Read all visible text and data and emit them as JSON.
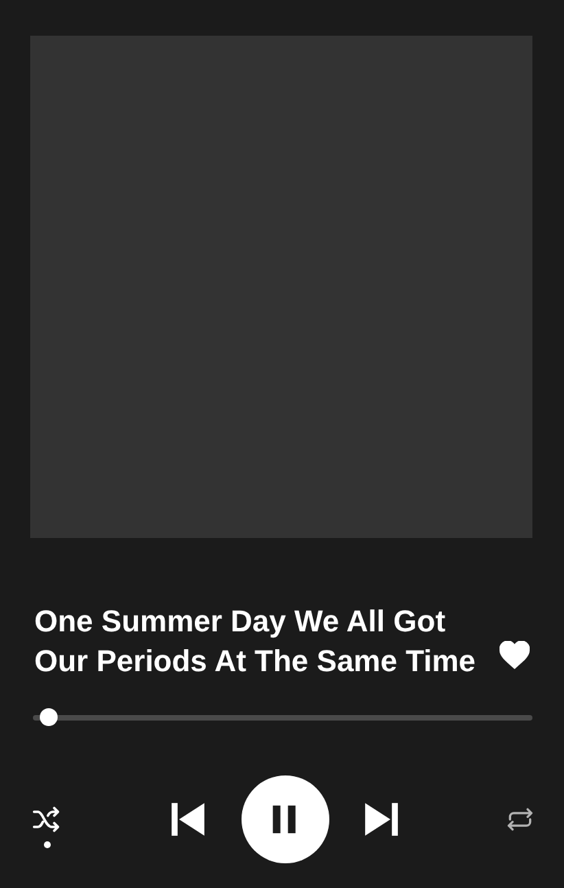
{
  "track": {
    "title": "One Summer Day We All Got Our Periods At The Same Time",
    "liked": true
  },
  "progress": {
    "level": 0.02
  },
  "controls": {
    "shuffle": true,
    "playing": true,
    "repeat": false
  }
}
